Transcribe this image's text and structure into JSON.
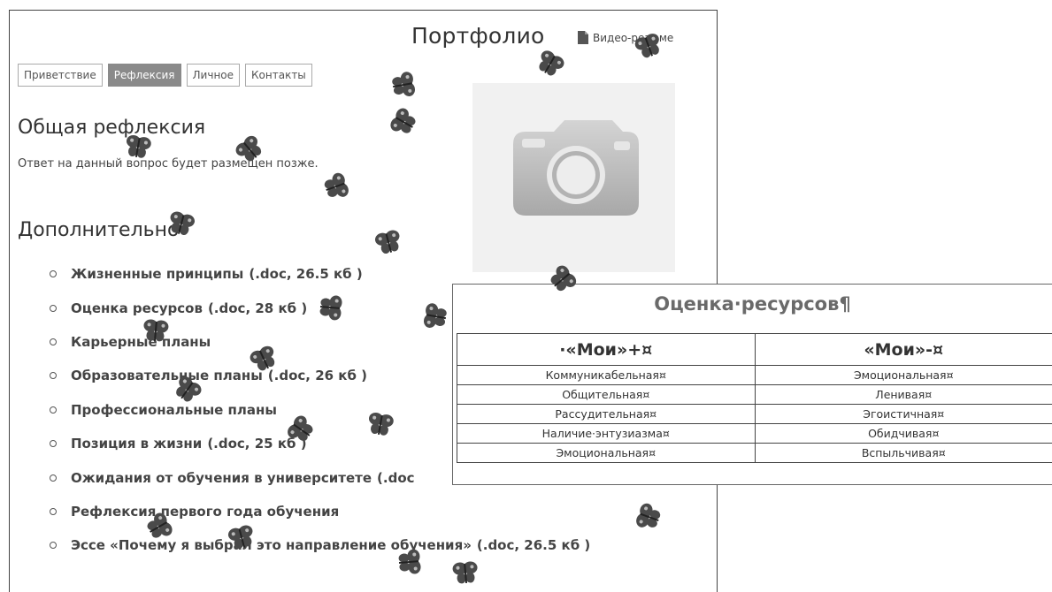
{
  "header": {
    "title": "Портфолио",
    "video_resume": "Видео-резюме",
    "video_icon": "document-icon"
  },
  "tabs": [
    {
      "label": "Приветствие",
      "active": false
    },
    {
      "label": "Рефлексия",
      "active": true
    },
    {
      "label": "Личное",
      "active": false
    },
    {
      "label": "Контакты",
      "active": false
    }
  ],
  "general": {
    "heading": "Общая рефлексия",
    "answer": "Ответ на данный вопрос будет размещен позже."
  },
  "extra": {
    "heading": "Дополнительно",
    "documents": [
      {
        "title": "Жизненные принципы",
        "suffix": "(.doc, 26.5 кб )"
      },
      {
        "title": "Оценка ресурсов",
        "suffix": "(.doc, 28 кб )"
      },
      {
        "title": "Карьерные планы",
        "suffix": ""
      },
      {
        "title": "Образовательные планы",
        "suffix": "(.doc, 26 кб )"
      },
      {
        "title": "Профессиональные планы",
        "suffix": ""
      },
      {
        "title": "Позиция в жизни",
        "suffix": "(.doc, 25 кб )"
      },
      {
        "title": "Ожидания от обучения в университете",
        "suffix": "(.doc"
      },
      {
        "title": "Рефлексия первого года обучения",
        "suffix": ""
      },
      {
        "title": "Эссе «Почему я выбрал это направление обучения»",
        "suffix": "(.doc, 26.5 кб )"
      }
    ]
  },
  "photo": {
    "icon": "camera-icon"
  },
  "resource_doc": {
    "title": "Оценка·ресурсов¶",
    "col_plus": "·«Мои»+¤",
    "col_minus": "«Мои»-¤",
    "rows": [
      [
        "Коммуникабельная¤",
        "Эмоциональная¤"
      ],
      [
        "Общительная¤",
        "Ленивая¤"
      ],
      [
        "Рассудительная¤",
        "Эгоистичная¤"
      ],
      [
        "Наличие·энтузиазма¤",
        "Обидчивая¤"
      ],
      [
        "Эмоциональная¤",
        "Вспыльчивая¤"
      ]
    ]
  },
  "decoration": {
    "icon": "butterfly-icon"
  }
}
